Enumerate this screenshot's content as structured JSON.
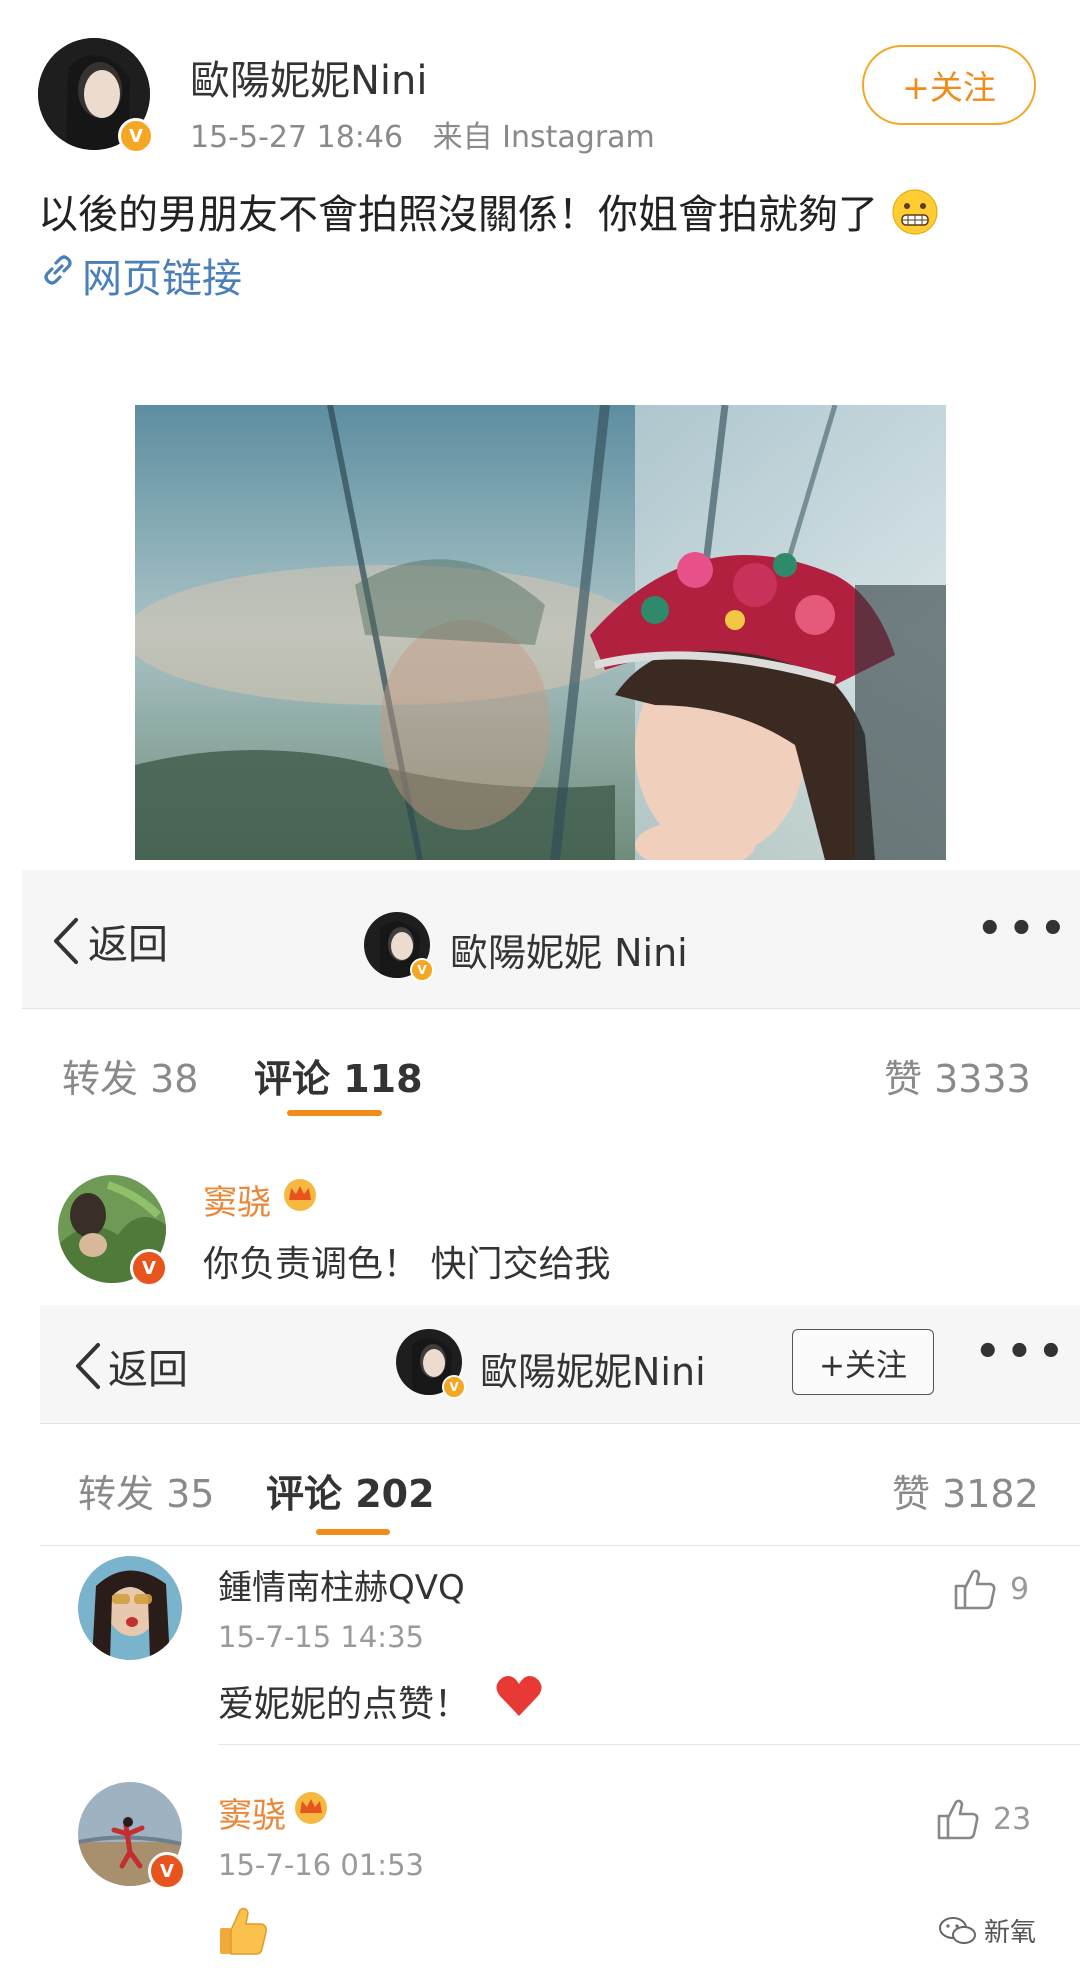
{
  "post": {
    "author": "歐陽妮妮Nini",
    "timestamp": "15-5-27 18:46",
    "source": "来自 Instagram",
    "follow_label": "+关注",
    "text": "以後的男朋友不會拍照沒關係！你姐會拍就夠了",
    "emoji": "grimacing-face",
    "link_label": "网页链接"
  },
  "panel1": {
    "back_label": "返回",
    "title": "歐陽妮妮 Nini",
    "tabs": {
      "repost": "转发 38",
      "comments": "评论 118",
      "likes": "赞 3333"
    },
    "comment": {
      "name": "窦骁",
      "text": "你负责调色！ 快门交给我"
    }
  },
  "panel2": {
    "back_label": "返回",
    "title": "歐陽妮妮Nini",
    "follow_label": "+关注",
    "tabs": {
      "repost": "转发 35",
      "comments": "评论 202",
      "likes": "赞 3182"
    },
    "comments": [
      {
        "name": "鍾情南柱赫QVQ",
        "time": "15-7-15 14:35",
        "text": "爱妮妮的点赞！",
        "likes": "9"
      },
      {
        "name": "窦骁",
        "time": "15-7-16 01:53",
        "text": "",
        "likes": "23"
      }
    ]
  },
  "watermark": "新氧",
  "colors": {
    "accent_orange": "#f08c1a",
    "link_blue": "#4a7fb8",
    "verified_gold": "#f5a623",
    "verified_red": "#e8541e"
  }
}
